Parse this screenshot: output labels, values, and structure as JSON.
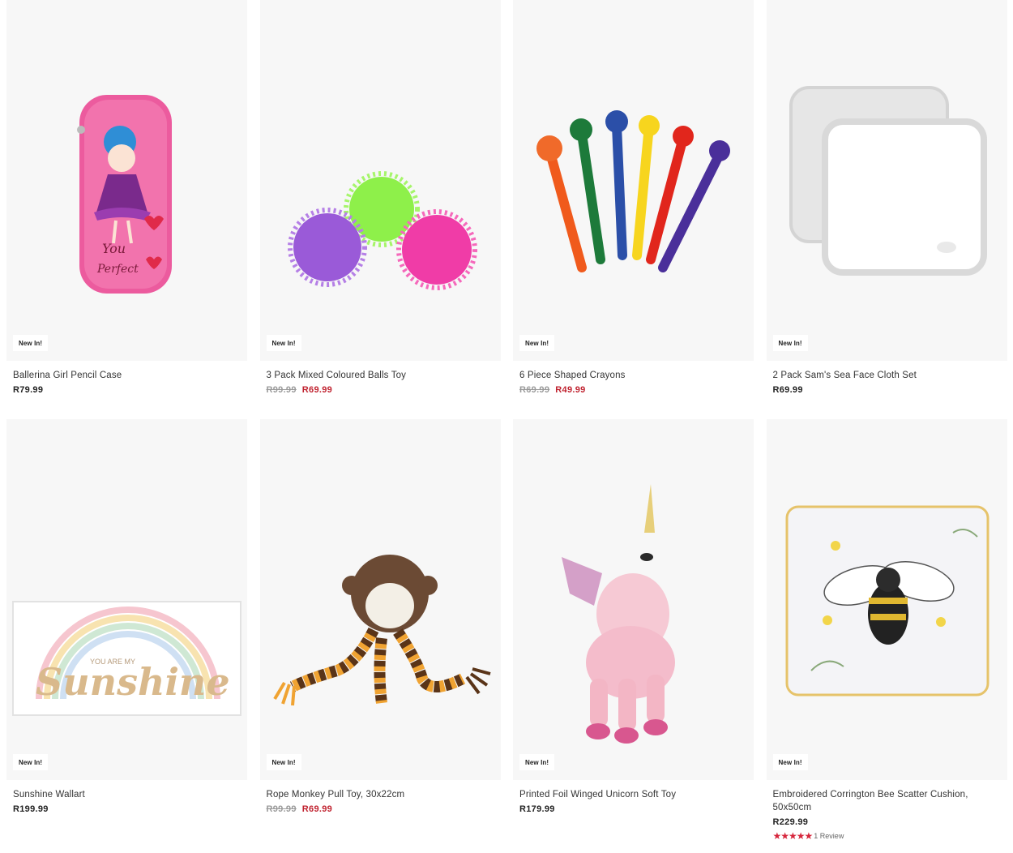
{
  "products": [
    {
      "badge": "New In!",
      "title": "Ballerina Girl Pencil Case",
      "price": "R79.99",
      "icon": "pencil-case-image"
    },
    {
      "badge": "New In!",
      "title": "3 Pack Mixed Coloured Balls Toy",
      "was": "R99.99",
      "now": "R69.99",
      "icon": "spiky-balls-image"
    },
    {
      "badge": "New In!",
      "title": "6 Piece Shaped Crayons",
      "was": "R69.99",
      "now": "R49.99",
      "icon": "crayons-image"
    },
    {
      "badge": "New In!",
      "title": "2 Pack Sam's Sea Face Cloth Set",
      "price": "R69.99",
      "icon": "face-cloth-image"
    },
    {
      "badge": "New In!",
      "title": "Sunshine Wallart",
      "price": "R199.99",
      "icon": "wallart-image",
      "art_text_small": "YOU ARE MY",
      "art_text_big": "Sunshine"
    },
    {
      "badge": "New In!",
      "title": "Rope Monkey Pull Toy, 30x22cm",
      "was": "R99.99",
      "now": "R69.99",
      "icon": "monkey-toy-image"
    },
    {
      "badge": "New In!",
      "title": "Printed Foil Winged Unicorn Soft Toy",
      "price": "R179.99",
      "icon": "unicorn-image"
    },
    {
      "badge": "New In!",
      "title": "Embroidered Corrington Bee Scatter Cushion, 50x50cm",
      "price": "R229.99",
      "rating": 5,
      "reviews": "1 Review",
      "icon": "bee-cushion-image"
    }
  ],
  "colors": {
    "sale": "#c0222f",
    "stars": "#d6263c",
    "card_bg": "#f7f7f7"
  }
}
